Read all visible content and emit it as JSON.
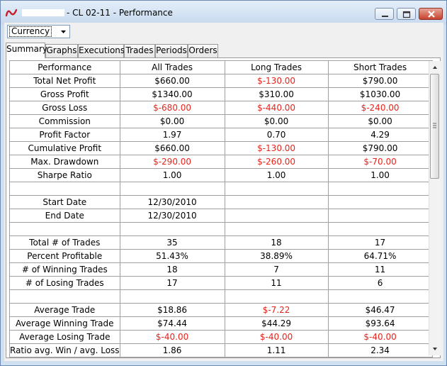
{
  "window": {
    "title": "- CL 02-11 - Performance",
    "icon": "ninjatrader-logo-icon",
    "controls": [
      "minimize-icon",
      "maximize-icon",
      "close-icon"
    ]
  },
  "currency_select": {
    "value": "Currency"
  },
  "tabs": [
    {
      "label": "Summary",
      "active": true
    },
    {
      "label": "Graphs",
      "active": false
    },
    {
      "label": "Executions",
      "active": false
    },
    {
      "label": "Trades",
      "active": false
    },
    {
      "label": "Periods",
      "active": false
    },
    {
      "label": "Orders",
      "active": false
    }
  ],
  "table": {
    "headers": [
      "Performance",
      "All Trades",
      "Long Trades",
      "Short Trades"
    ],
    "rows": [
      {
        "label": "Total Net Profit",
        "all": "$660.00",
        "long": "$-130.00",
        "short": "$790.00",
        "neg": [
          false,
          true,
          false
        ]
      },
      {
        "label": "Gross Profit",
        "all": "$1340.00",
        "long": "$310.00",
        "short": "$1030.00",
        "neg": [
          false,
          false,
          false
        ]
      },
      {
        "label": "Gross Loss",
        "all": "$-680.00",
        "long": "$-440.00",
        "short": "$-240.00",
        "neg": [
          true,
          true,
          true
        ]
      },
      {
        "label": "Commission",
        "all": "$0.00",
        "long": "$0.00",
        "short": "$0.00",
        "neg": [
          false,
          false,
          false
        ]
      },
      {
        "label": "Profit Factor",
        "all": "1.97",
        "long": "0.70",
        "short": "4.29",
        "neg": [
          false,
          false,
          false
        ]
      },
      {
        "label": "Cumulative Profit",
        "all": "$660.00",
        "long": "$-130.00",
        "short": "$790.00",
        "neg": [
          false,
          true,
          false
        ]
      },
      {
        "label": "Max. Drawdown",
        "all": "$-290.00",
        "long": "$-260.00",
        "short": "$-70.00",
        "neg": [
          true,
          true,
          true
        ]
      },
      {
        "label": "Sharpe Ratio",
        "all": "1.00",
        "long": "1.00",
        "short": "1.00",
        "neg": [
          false,
          false,
          false
        ]
      },
      {
        "label": "",
        "all": "",
        "long": "",
        "short": "",
        "neg": [
          false,
          false,
          false
        ]
      },
      {
        "label": "Start Date",
        "all": "12/30/2010",
        "long": "",
        "short": "",
        "neg": [
          false,
          false,
          false
        ]
      },
      {
        "label": "End Date",
        "all": "12/30/2010",
        "long": "",
        "short": "",
        "neg": [
          false,
          false,
          false
        ]
      },
      {
        "label": "",
        "all": "",
        "long": "",
        "short": "",
        "neg": [
          false,
          false,
          false
        ]
      },
      {
        "label": "Total # of Trades",
        "all": "35",
        "long": "18",
        "short": "17",
        "neg": [
          false,
          false,
          false
        ]
      },
      {
        "label": "Percent Profitable",
        "all": "51.43%",
        "long": "38.89%",
        "short": "64.71%",
        "neg": [
          false,
          false,
          false
        ]
      },
      {
        "label": "# of Winning Trades",
        "all": "18",
        "long": "7",
        "short": "11",
        "neg": [
          false,
          false,
          false
        ]
      },
      {
        "label": "# of Losing Trades",
        "all": "17",
        "long": "11",
        "short": "6",
        "neg": [
          false,
          false,
          false
        ]
      },
      {
        "label": "",
        "all": "",
        "long": "",
        "short": "",
        "neg": [
          false,
          false,
          false
        ]
      },
      {
        "label": "Average Trade",
        "all": "$18.86",
        "long": "$-7.22",
        "short": "$46.47",
        "neg": [
          false,
          true,
          false
        ]
      },
      {
        "label": "Average Winning Trade",
        "all": "$74.44",
        "long": "$44.29",
        "short": "$93.64",
        "neg": [
          false,
          false,
          false
        ]
      },
      {
        "label": "Average Losing Trade",
        "all": "$-40.00",
        "long": "$-40.00",
        "short": "$-40.00",
        "neg": [
          true,
          true,
          true
        ]
      },
      {
        "label": "Ratio avg. Win / avg. Loss",
        "all": "1.86",
        "long": "1.11",
        "short": "2.34",
        "neg": [
          false,
          false,
          false
        ]
      }
    ]
  },
  "colors": {
    "negative": "#e8231a",
    "title_bar": "#c7d9ee",
    "close_button": "#c7432c"
  }
}
